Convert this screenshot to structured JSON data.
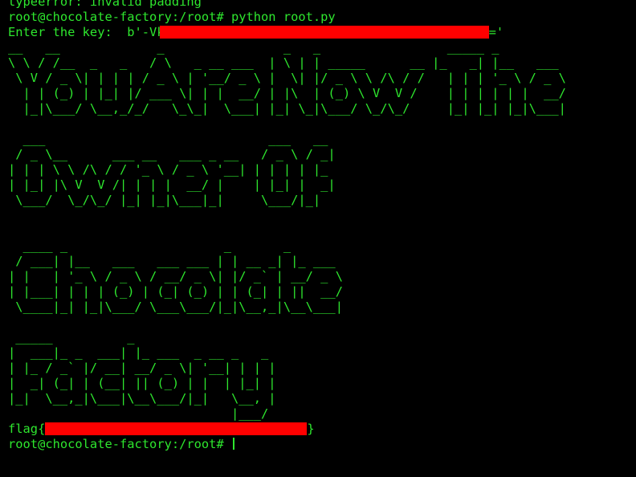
{
  "terminal": {
    "lines_before": [
      "typeerror: invalid padding",
      "root@chocolate-factory:/root# python root.py"
    ],
    "key_prefix": "Enter the key:  b'-Vk",
    "key_suffix": "='",
    "banner": [
      "__   __             _                _   _                 _____ _            ",
      "\\ \\ / /__  _   _   / \\   _ __ ___  | \\ | | _____      __ |_   _| |__   ___ ",
      " \\ V / _ \\| | | | / _ \\ | '__/ _ \\ |  \\| |/ _ \\ \\ /\\ / /   | | | '_ \\ / _ \\",
      "  | | (_) | |_| |/ ___ \\| | |  __/ | |\\  | (_) \\ V  V /    | | | | | |  __/",
      "  |_|\\___/ \\__,_/_/   \\_\\_|  \\___| |_| \\_|\\___/ \\_/\\_/     |_| |_| |_|\\___|",
      "",
      "  ___                              ___   __  ",
      " / _ \\__      ___ __   ___ _ __   / _ \\ / _| ",
      "| | | \\ \\ /\\ / / '_ \\ / _ \\ '__| | | | | |_  ",
      "| |_| |\\ V  V /| | | |  __/ |    | |_| |  _| ",
      " \\___/  \\_/\\_/ |_| |_|\\___|_|     \\___/|_|   ",
      "",
      "",
      "  ____ _                     _       _       ",
      " / ___| |__   ___   ___ ___ | | __ _| |_ ___ ",
      "| |   | '_ \\ / _ \\ / __/ _ \\| |/ _` | __/ _ \\",
      "| |___| | | | (_) | (_| (_) | | (_| | ||  __/",
      " \\____|_| |_|\\___/ \\___\\___/|_|\\__,_|\\__\\___|",
      "",
      " _____          _                    ",
      "|  ___|_ _  ___| |_ ___  _ __ _   _  ",
      "| |_ / _` |/ __| __/ _ \\| '__| | | | ",
      "|  _| (_| | (__| || (_) | |  | |_| | ",
      "|_|  \\__,_|\\___|\\__\\___/|_|   \\__, | ",
      "                              |___/  "
    ],
    "blank_after_banner": "",
    "flag_prefix": "flag{",
    "flag_suffix": "}",
    "prompt": "root@chocolate-factory:/root# ",
    "colors": {
      "text": "#2ee62e",
      "background": "#000000",
      "redaction": "#ff0000"
    }
  }
}
